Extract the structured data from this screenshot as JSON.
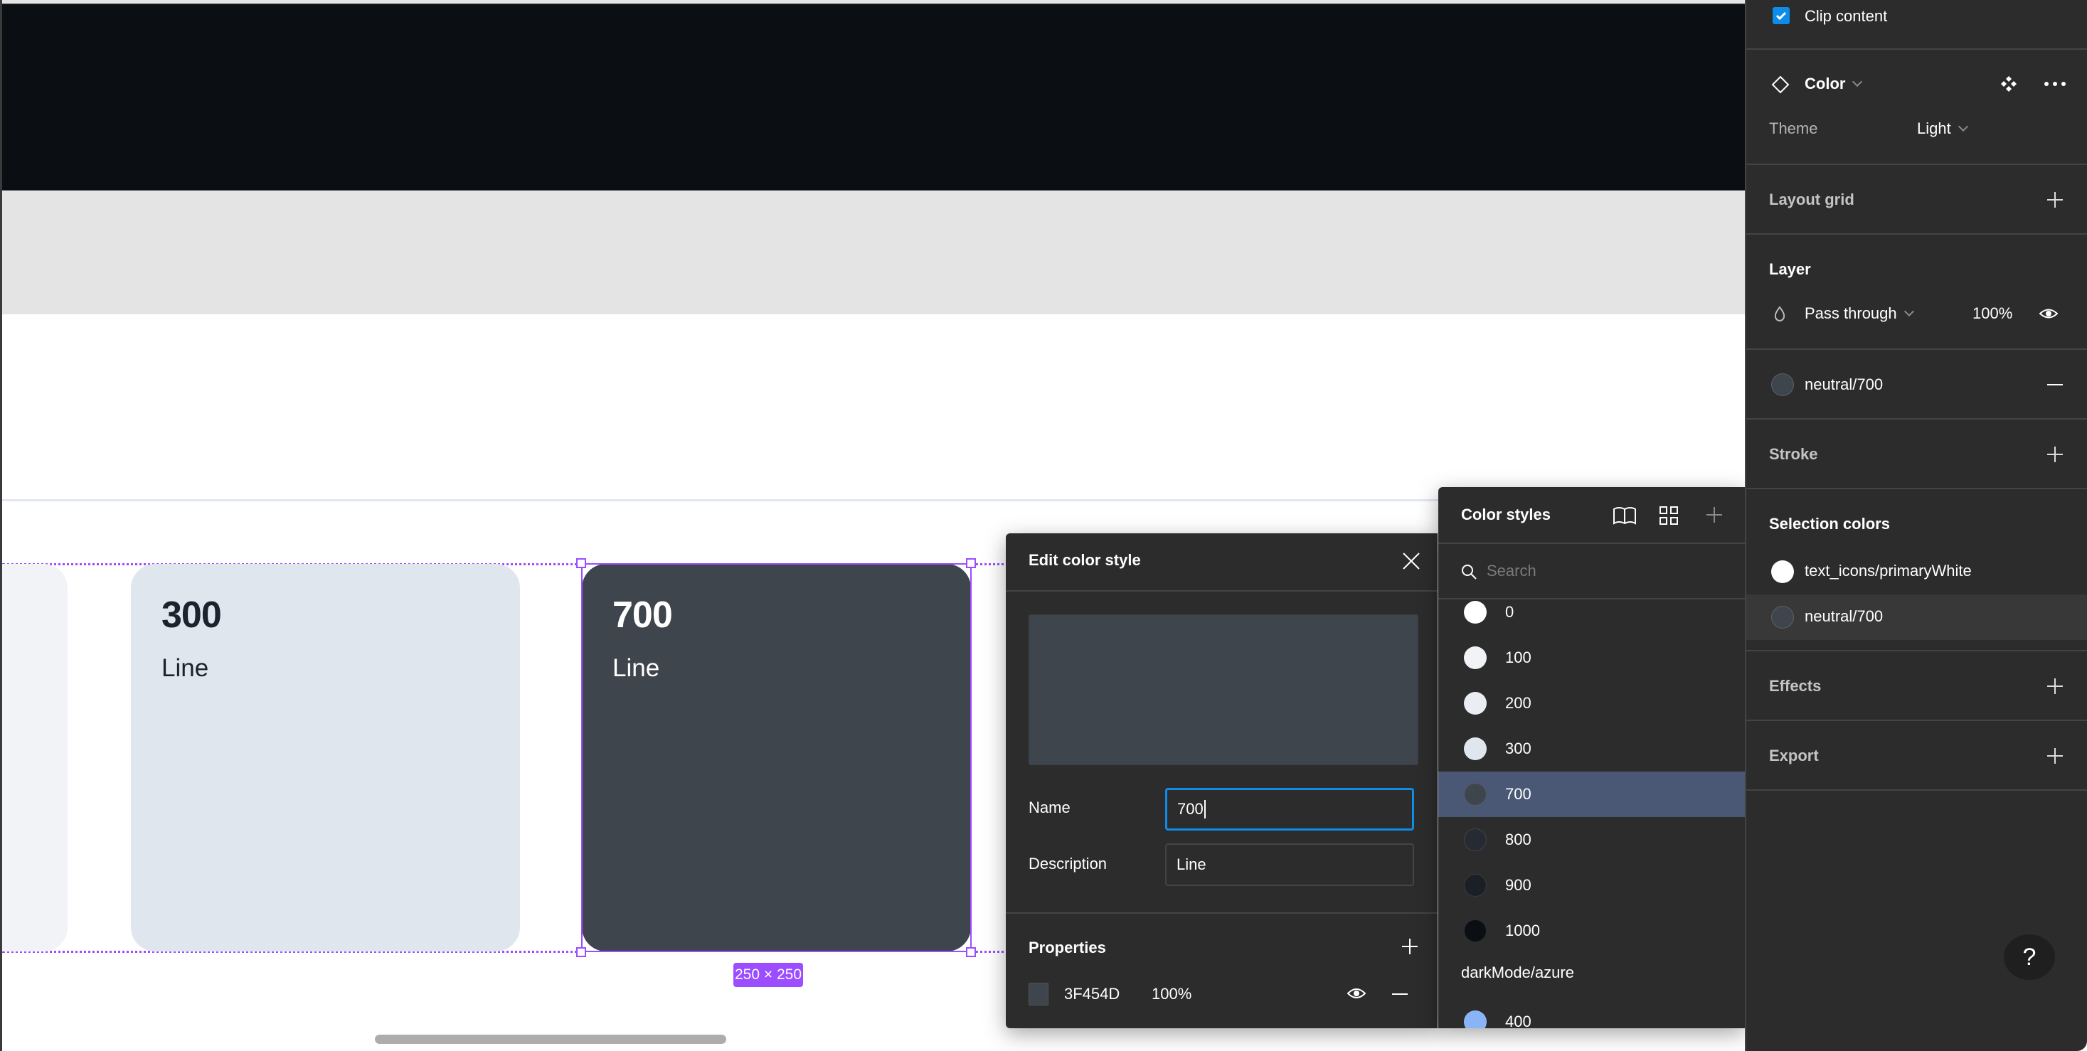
{
  "canvas": {
    "cards": [
      {
        "title": "300",
        "subtitle": "Line",
        "color": "#E0E6EE"
      },
      {
        "title": "700",
        "subtitle": "Line",
        "color": "#3F454D"
      }
    ],
    "selection_size": "250 × 250"
  },
  "edit_dialog": {
    "title": "Edit color style",
    "preview_color": "#3F454D",
    "name_label": "Name",
    "name_value": "700",
    "description_label": "Description",
    "description_value": "Line",
    "properties_title": "Properties",
    "property": {
      "hex": "3F454D",
      "opacity": "100%"
    }
  },
  "styles_panel": {
    "title": "Color styles",
    "search_placeholder": "Search",
    "items": [
      {
        "label": "0",
        "color": "#FFFFFF",
        "selected": false
      },
      {
        "label": "100",
        "color": "#F1F3F7",
        "selected": false
      },
      {
        "label": "200",
        "color": "#EAEDF2",
        "selected": false
      },
      {
        "label": "300",
        "color": "#E0E6EE",
        "selected": false
      },
      {
        "label": "700",
        "color": "#3F454D",
        "selected": true
      },
      {
        "label": "800",
        "color": "#262B33",
        "selected": false
      },
      {
        "label": "900",
        "color": "#1B1F26",
        "selected": false
      },
      {
        "label": "1000",
        "color": "#0B0E13",
        "selected": false
      }
    ],
    "group_label": "darkMode/azure",
    "group_items": [
      {
        "label": "400",
        "color": "#8AB4F8"
      }
    ]
  },
  "properties_panel": {
    "clip_content_label": "Clip content",
    "clip_content_checked": true,
    "color_section": {
      "title": "Color",
      "theme_label": "Theme",
      "theme_value": "Light"
    },
    "layout_grid_title": "Layout grid",
    "layer": {
      "title": "Layer",
      "blend_mode": "Pass through",
      "opacity": "100%"
    },
    "fill": {
      "name": "neutral/700",
      "color": "#3F454D"
    },
    "stroke_title": "Stroke",
    "selection_colors": {
      "title": "Selection colors",
      "items": [
        {
          "name": "text_icons/primaryWhite",
          "color": "#FFFFFF"
        },
        {
          "name": "neutral/700",
          "color": "#3F454D"
        }
      ]
    },
    "effects_title": "Effects",
    "export_title": "Export",
    "help_label": "?"
  },
  "colors": {
    "accent_blue": "#0D8CE9",
    "selection_purple": "#9B4DFF",
    "panel_bg": "#2C2C2C",
    "selected_row": "#4A5875"
  }
}
